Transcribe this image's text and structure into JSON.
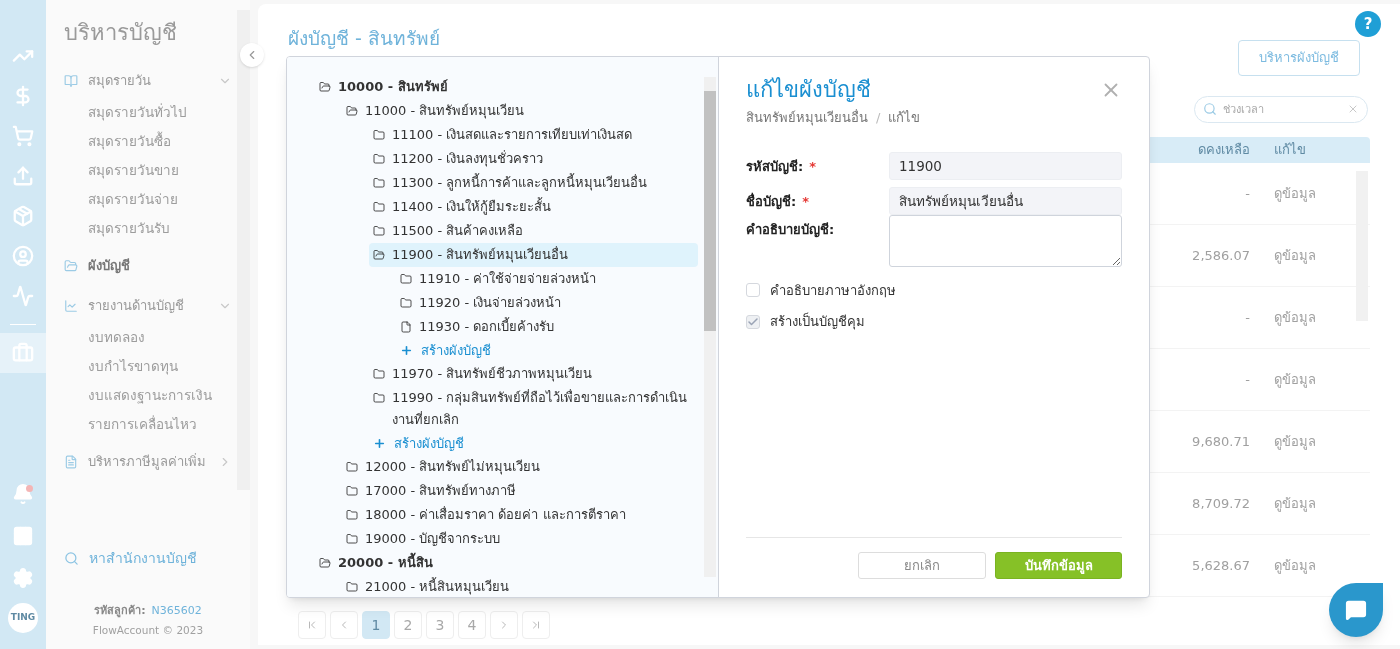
{
  "rail": {
    "top": [
      {
        "selected": false
      },
      {
        "selected": false
      },
      {
        "selected": false
      },
      {
        "selected": false
      },
      {
        "selected": false
      },
      {
        "selected": false
      },
      {
        "selected": false
      },
      {
        "selected": true
      }
    ],
    "bottom": [
      {
        "kind": "bell",
        "badge": true
      },
      {
        "kind": "apps"
      },
      {
        "kind": "settings"
      }
    ],
    "avatar": "TING"
  },
  "sidebar": {
    "title": "บริหารบัญชี",
    "groups": [
      {
        "label": "สมุดรายวัน",
        "selected": false,
        "expanded": true,
        "items": [
          "สมุดรายวันทั่วไป",
          "สมุดรายวันซื้อ",
          "สมุดรายวันขาย",
          "สมุดรายวันจ่าย",
          "สมุดรายวันรับ"
        ]
      },
      {
        "label": "ผังบัญชี",
        "selected": true
      },
      {
        "label": "รายงานด้านบัญชี",
        "selected": false,
        "expanded": true,
        "items": [
          "งบทดลอง",
          "งบกำไรขาดทุน",
          "งบแสดงฐานะการเงิน",
          "รายการเคลื่อนไหว"
        ]
      },
      {
        "label": "บริหารภาษีมูลค่าเพิ่ม",
        "selected": false,
        "expanded": false
      }
    ],
    "find_accountant": "หาสำนักงานบัญชี",
    "customer_label": "รหัสลูกค้า:",
    "customer_id": "N365602",
    "copyright": "FlowAccount © 2023"
  },
  "page": {
    "title": "ผังบัญชี - สินทรัพย์",
    "manage_button": "บริหารผังบัญชี",
    "search": {
      "placeholder": "ช่วงเวลา"
    },
    "table": {
      "columns": [
        "ดคงเหลือ",
        "แก้ไข"
      ],
      "rows": [
        {
          "balance": "-",
          "action": "ดูข้อมูล"
        },
        {
          "balance": "2,586.07",
          "action": "ดูข้อมูล"
        },
        {
          "balance": "-",
          "action": "ดูข้อมูล"
        },
        {
          "balance": "-",
          "action": "ดูข้อมูล"
        },
        {
          "balance": "9,680.71",
          "action": "ดูข้อมูล"
        },
        {
          "balance": "8,709.72",
          "action": "ดูข้อมูล"
        },
        {
          "balance": "5,628.67",
          "action": "ดูข้อมูล"
        }
      ]
    },
    "pagination": [
      {
        "kind": "first",
        "selected": false
      },
      {
        "kind": "prev",
        "selected": false
      },
      {
        "kind": "page",
        "label": "1",
        "selected": true
      },
      {
        "kind": "page",
        "label": "2",
        "selected": false
      },
      {
        "kind": "page",
        "label": "3",
        "selected": false
      },
      {
        "kind": "page",
        "label": "4",
        "selected": false
      },
      {
        "kind": "next",
        "selected": false
      },
      {
        "kind": "last",
        "selected": false
      }
    ]
  },
  "modal": {
    "tree": [
      {
        "kind": "folder",
        "label": "10000 - สินทรัพย์",
        "expanded": true,
        "selected": false,
        "children": [
          {
            "kind": "folder",
            "label": "11000 - สินทรัพย์หมุนเวียน",
            "expanded": true,
            "selected": false,
            "children": [
              {
                "kind": "folder",
                "label": "11100 - เงินสดและรายการเทียบเท่าเงินสด",
                "expanded": false,
                "selected": false
              },
              {
                "kind": "folder",
                "label": "11200 - เงินลงทุนชั่วคราว",
                "expanded": false,
                "selected": false
              },
              {
                "kind": "folder",
                "label": "11300 - ลูกหนี้การค้าและลูกหนี้หมุนเวียนอื่น",
                "expanded": false,
                "selected": false
              },
              {
                "kind": "folder",
                "label": "11400 - เงินให้กู้ยืมระยะสั้น",
                "expanded": false,
                "selected": false
              },
              {
                "kind": "folder",
                "label": "11500 - สินค้าคงเหลือ",
                "expanded": false,
                "selected": false
              },
              {
                "kind": "folder",
                "label": "11900 - สินทรัพย์หมุนเวียนอื่น",
                "expanded": true,
                "selected": true,
                "children": [
                  {
                    "kind": "folder",
                    "label": "11910 - ค่าใช้จ่ายจ่ายล่วงหน้า",
                    "expanded": false,
                    "selected": false
                  },
                  {
                    "kind": "folder",
                    "label": "11920 - เงินจ่ายล่วงหน้า",
                    "expanded": false,
                    "selected": false
                  },
                  {
                    "kind": "file",
                    "label": "11930 - ดอกเบี้ยค้างรับ",
                    "expanded": false,
                    "selected": false
                  },
                  {
                    "kind": "add",
                    "label": "สร้างผังบัญชี"
                  }
                ]
              },
              {
                "kind": "folder",
                "label": "11970 - สินทรัพย์ชีวภาพหมุนเวียน",
                "expanded": false,
                "selected": false
              },
              {
                "kind": "folder",
                "label": "11990 - กลุ่มสินทรัพย์ที่ถือไว้เพื่อขายและการดำเนินงานที่ยกเลิก",
                "expanded": false,
                "selected": false
              },
              {
                "kind": "add",
                "label": "สร้างผังบัญชี"
              }
            ]
          },
          {
            "kind": "folder",
            "label": "12000 - สินทรัพย์ไม่หมุนเวียน",
            "expanded": false,
            "selected": false
          },
          {
            "kind": "folder",
            "label": "17000 - สินทรัพย์ทางภาษี",
            "expanded": false,
            "selected": false
          },
          {
            "kind": "folder",
            "label": "18000 - ค่าเสื่อมราคา ด้อยค่า และการตีราคา",
            "expanded": false,
            "selected": false
          },
          {
            "kind": "folder",
            "label": "19000 - บัญชีจากระบบ",
            "expanded": false,
            "selected": false
          }
        ]
      },
      {
        "kind": "folder",
        "label": "20000 - หนี้สิน",
        "expanded": true,
        "selected": false,
        "children": [
          {
            "kind": "folder",
            "label": "21000 - หนี้สินหมุนเวียน",
            "expanded": false,
            "selected": false
          }
        ]
      }
    ],
    "title": "แก้ไขผังบัญชี",
    "breadcrumb": [
      "สินทรัพย์หมุนเวียนอื่น",
      "แก้ไข"
    ],
    "breadcrumb_separator": "/",
    "fields": [
      {
        "label": "รหัสบัญชี:",
        "required": true,
        "kind": "input",
        "value": "11900"
      },
      {
        "label": "ชื่อบัญชี:",
        "required": true,
        "kind": "input",
        "value": "สินทรัพย์หมุนเวียนอื่น"
      },
      {
        "label": "คำอธิบายบัญชี:",
        "kind": "textarea"
      }
    ],
    "required_mark": "*",
    "checkboxes": [
      {
        "label": "คำอธิบายภาษาอังกฤษ",
        "checked": false
      },
      {
        "label": "สร้างเป็นบัญชีคุม",
        "checked": true
      }
    ],
    "cancel": "ยกเลิก",
    "save": "บันทึกข้อมูล"
  },
  "help": "?"
}
